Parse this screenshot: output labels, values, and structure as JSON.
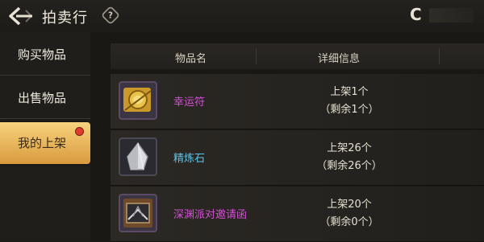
{
  "header": {
    "title": "拍卖行",
    "help_symbol": "?",
    "currency_symbol": "C"
  },
  "sidebar": {
    "items": [
      {
        "label": "购买物品",
        "active": false
      },
      {
        "label": "出售物品",
        "active": false
      },
      {
        "label": "我的上架",
        "active": true,
        "badge": true
      }
    ]
  },
  "table": {
    "columns": [
      "物品名",
      "详细信息"
    ],
    "rows": [
      {
        "name": "幸运符",
        "name_color": "#d44fd6",
        "listed": "上架1个",
        "remaining": "（剩余1个）",
        "icon": "lucky-charm-icon"
      },
      {
        "name": "精炼石",
        "name_color": "#5cc3ea",
        "listed": "上架26个",
        "remaining": "（剩余26个）",
        "icon": "refining-stone-icon"
      },
      {
        "name": "深渊派对邀请函",
        "name_color": "#d44fd6",
        "listed": "上架20个",
        "remaining": "（剩余0个）",
        "icon": "abyss-party-invitation-icon"
      }
    ]
  },
  "colors": {
    "accent": "#e9b55a",
    "badge": "#e23a2e",
    "rare_purple": "#d44fd6",
    "rare_blue": "#5cc3ea"
  }
}
